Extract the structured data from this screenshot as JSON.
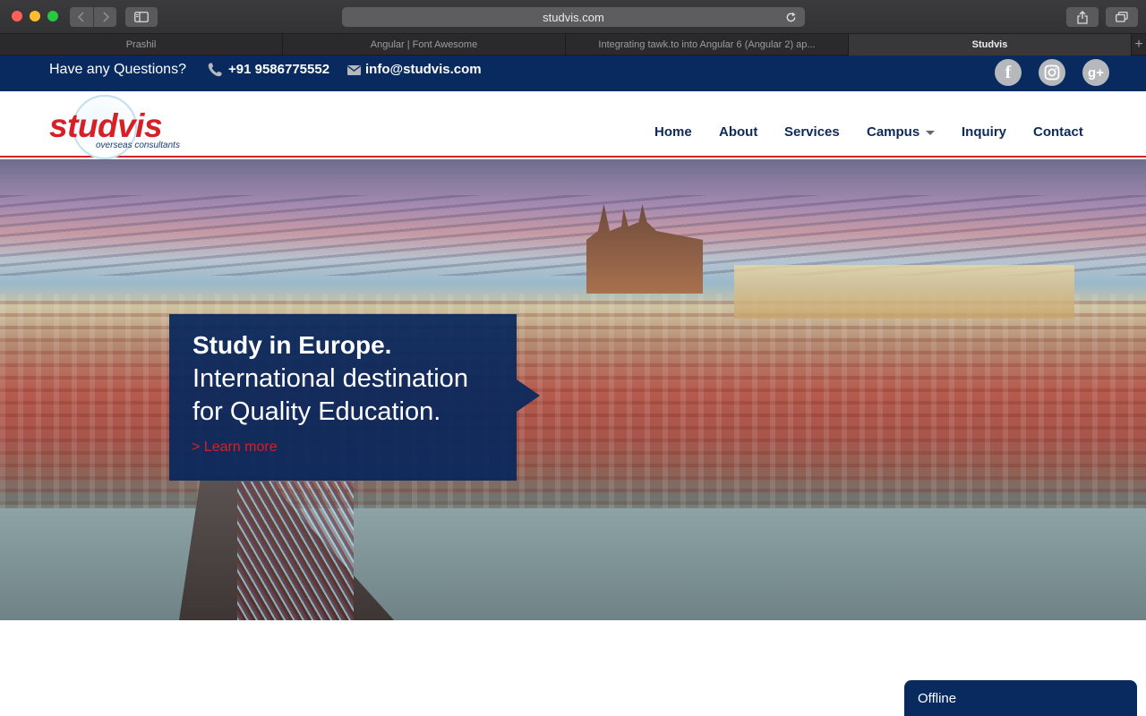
{
  "browser": {
    "url": "studvis.com",
    "tabs": [
      {
        "label": "Prashil",
        "active": false
      },
      {
        "label": "Angular | Font Awesome",
        "active": false
      },
      {
        "label": "Integrating tawk.to into Angular 6 (Angular 2) ap...",
        "active": false
      },
      {
        "label": "Studvis",
        "active": true
      }
    ],
    "new_tab_label": "+"
  },
  "topbar": {
    "question": "Have any Questions?",
    "phone": "+91 9586775552",
    "email": "info@studvis.com",
    "social": {
      "facebook": "f",
      "instagram": "instagram-icon",
      "googleplus": "g+"
    }
  },
  "logo": {
    "wordmark": "studvis",
    "tagline": "overseas consultants"
  },
  "nav": {
    "items": [
      {
        "label": "Home"
      },
      {
        "label": "About"
      },
      {
        "label": "Services"
      },
      {
        "label": "Campus",
        "has_dropdown": true
      },
      {
        "label": "Inquiry"
      },
      {
        "label": "Contact"
      }
    ]
  },
  "hero": {
    "title": "Study in Europe.",
    "line1": "International destination",
    "line2": "for Quality Education.",
    "cta": "> Learn more"
  },
  "chat": {
    "status": "Offline"
  },
  "colors": {
    "primary_navy": "#082a5e",
    "brand_red": "#d71f26"
  }
}
